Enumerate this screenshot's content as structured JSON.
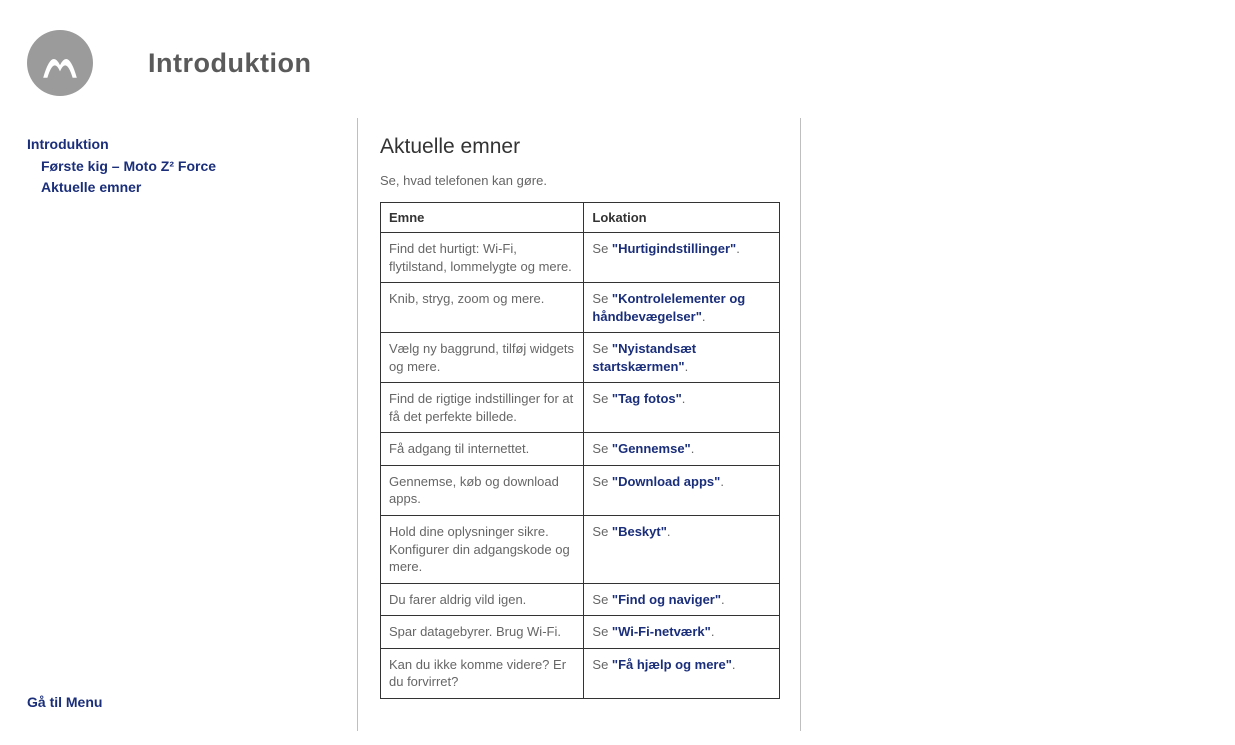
{
  "page_title": "Introduktion",
  "sidebar": {
    "items": [
      {
        "label": "Introduktion"
      },
      {
        "label": "Første kig – Moto Z² Force"
      },
      {
        "label": "Aktuelle emner"
      }
    ]
  },
  "menu_link": "Gå til Menu",
  "content": {
    "title": "Aktuelle emner",
    "subtitle": "Se, hvad telefonen kan gøre.",
    "table": {
      "headers": {
        "col1": "Emne",
        "col2": "Lokation"
      },
      "see_prefix": "Se ",
      "period": ".",
      "rows": [
        {
          "topic": "Find det hurtigt: Wi-Fi, flytilstand, lommelygte og mere.",
          "link": "\"Hurtigindstillinger\""
        },
        {
          "topic": "Knib, stryg, zoom og mere.",
          "link": "\"Kontrolelementer og håndbevægelser\""
        },
        {
          "topic": "Vælg ny baggrund, tilføj widgets og mere.",
          "link": "\"Nyistandsæt startskærmen\""
        },
        {
          "topic": "Find de rigtige indstillinger for at få det perfekte billede.",
          "link": "\"Tag fotos\""
        },
        {
          "topic": "Få adgang til internettet.",
          "link": "\"Gennemse\""
        },
        {
          "topic": "Gennemse, køb og download apps.",
          "link": "\"Download apps\""
        },
        {
          "topic": "Hold dine oplysninger sikre. Konfigurer din adgangskode og mere.",
          "link": "\"Beskyt\""
        },
        {
          "topic": "Du farer aldrig vild igen.",
          "link": "\"Find og naviger\""
        },
        {
          "topic": "Spar datagebyrer. Brug Wi-Fi.",
          "link": "\"Wi-Fi-netværk\""
        },
        {
          "topic": "Kan du ikke komme videre? Er du forvirret?",
          "link": "\"Få hjælp og mere\""
        }
      ]
    }
  }
}
